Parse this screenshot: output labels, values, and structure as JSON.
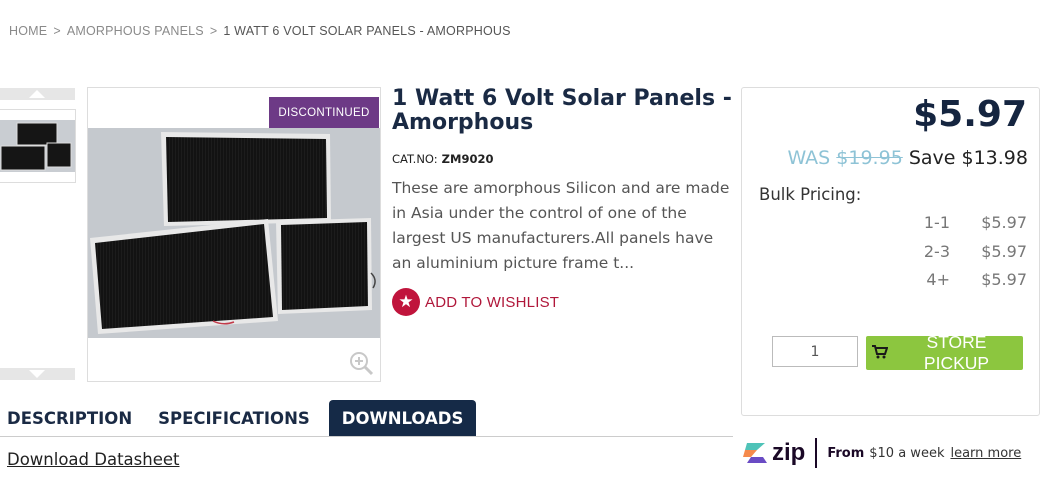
{
  "breadcrumb": {
    "home": "HOME",
    "category": "AMORPHOUS PANELS",
    "current": "1 WATT 6 VOLT SOLAR PANELS - AMORPHOUS",
    "separator": ">"
  },
  "product": {
    "badge": "DISCONTINUED",
    "title": "1 Watt 6 Volt Solar Panels - Amorphous",
    "catno_label": "CAT.NO:",
    "catno": "ZM9020",
    "description": "These are amorphous Silicon and are made in Asia under the control of one of the largest US manufacturers.All panels have an aluminium picture frame t...",
    "wishlist": "ADD TO WISHLIST",
    "icons": {
      "zoom": "zoom-in-icon",
      "wishlist": "star-icon",
      "cart": "cart-icon"
    }
  },
  "pricing": {
    "price": "$5.97",
    "was_label": "WAS",
    "was_price": "$19.95",
    "save": "Save $13.98",
    "bulk_title": "Bulk Pricing:",
    "bulk": [
      {
        "qty": "1-1",
        "price": "$5.97"
      },
      {
        "qty": "2-3",
        "price": "$5.97"
      },
      {
        "qty": "4+",
        "price": "$5.97"
      }
    ],
    "quantity": "1",
    "pickup_label": "STORE PICKUP"
  },
  "tabs": [
    {
      "label": "DESCRIPTION",
      "active": false
    },
    {
      "label": "SPECIFICATIONS",
      "active": false
    },
    {
      "label": "DOWNLOADS",
      "active": true
    }
  ],
  "downloads": {
    "link": "Download Datasheet"
  },
  "zip": {
    "logo": "zip",
    "from": "From",
    "amount": "$10 a week",
    "link": "learn more"
  },
  "colors": {
    "badge": "#6d3a86",
    "wishlist": "#c0143c",
    "pickup": "#8cc63f",
    "active_tab": "#152a47",
    "was": "#8ec3d6"
  }
}
